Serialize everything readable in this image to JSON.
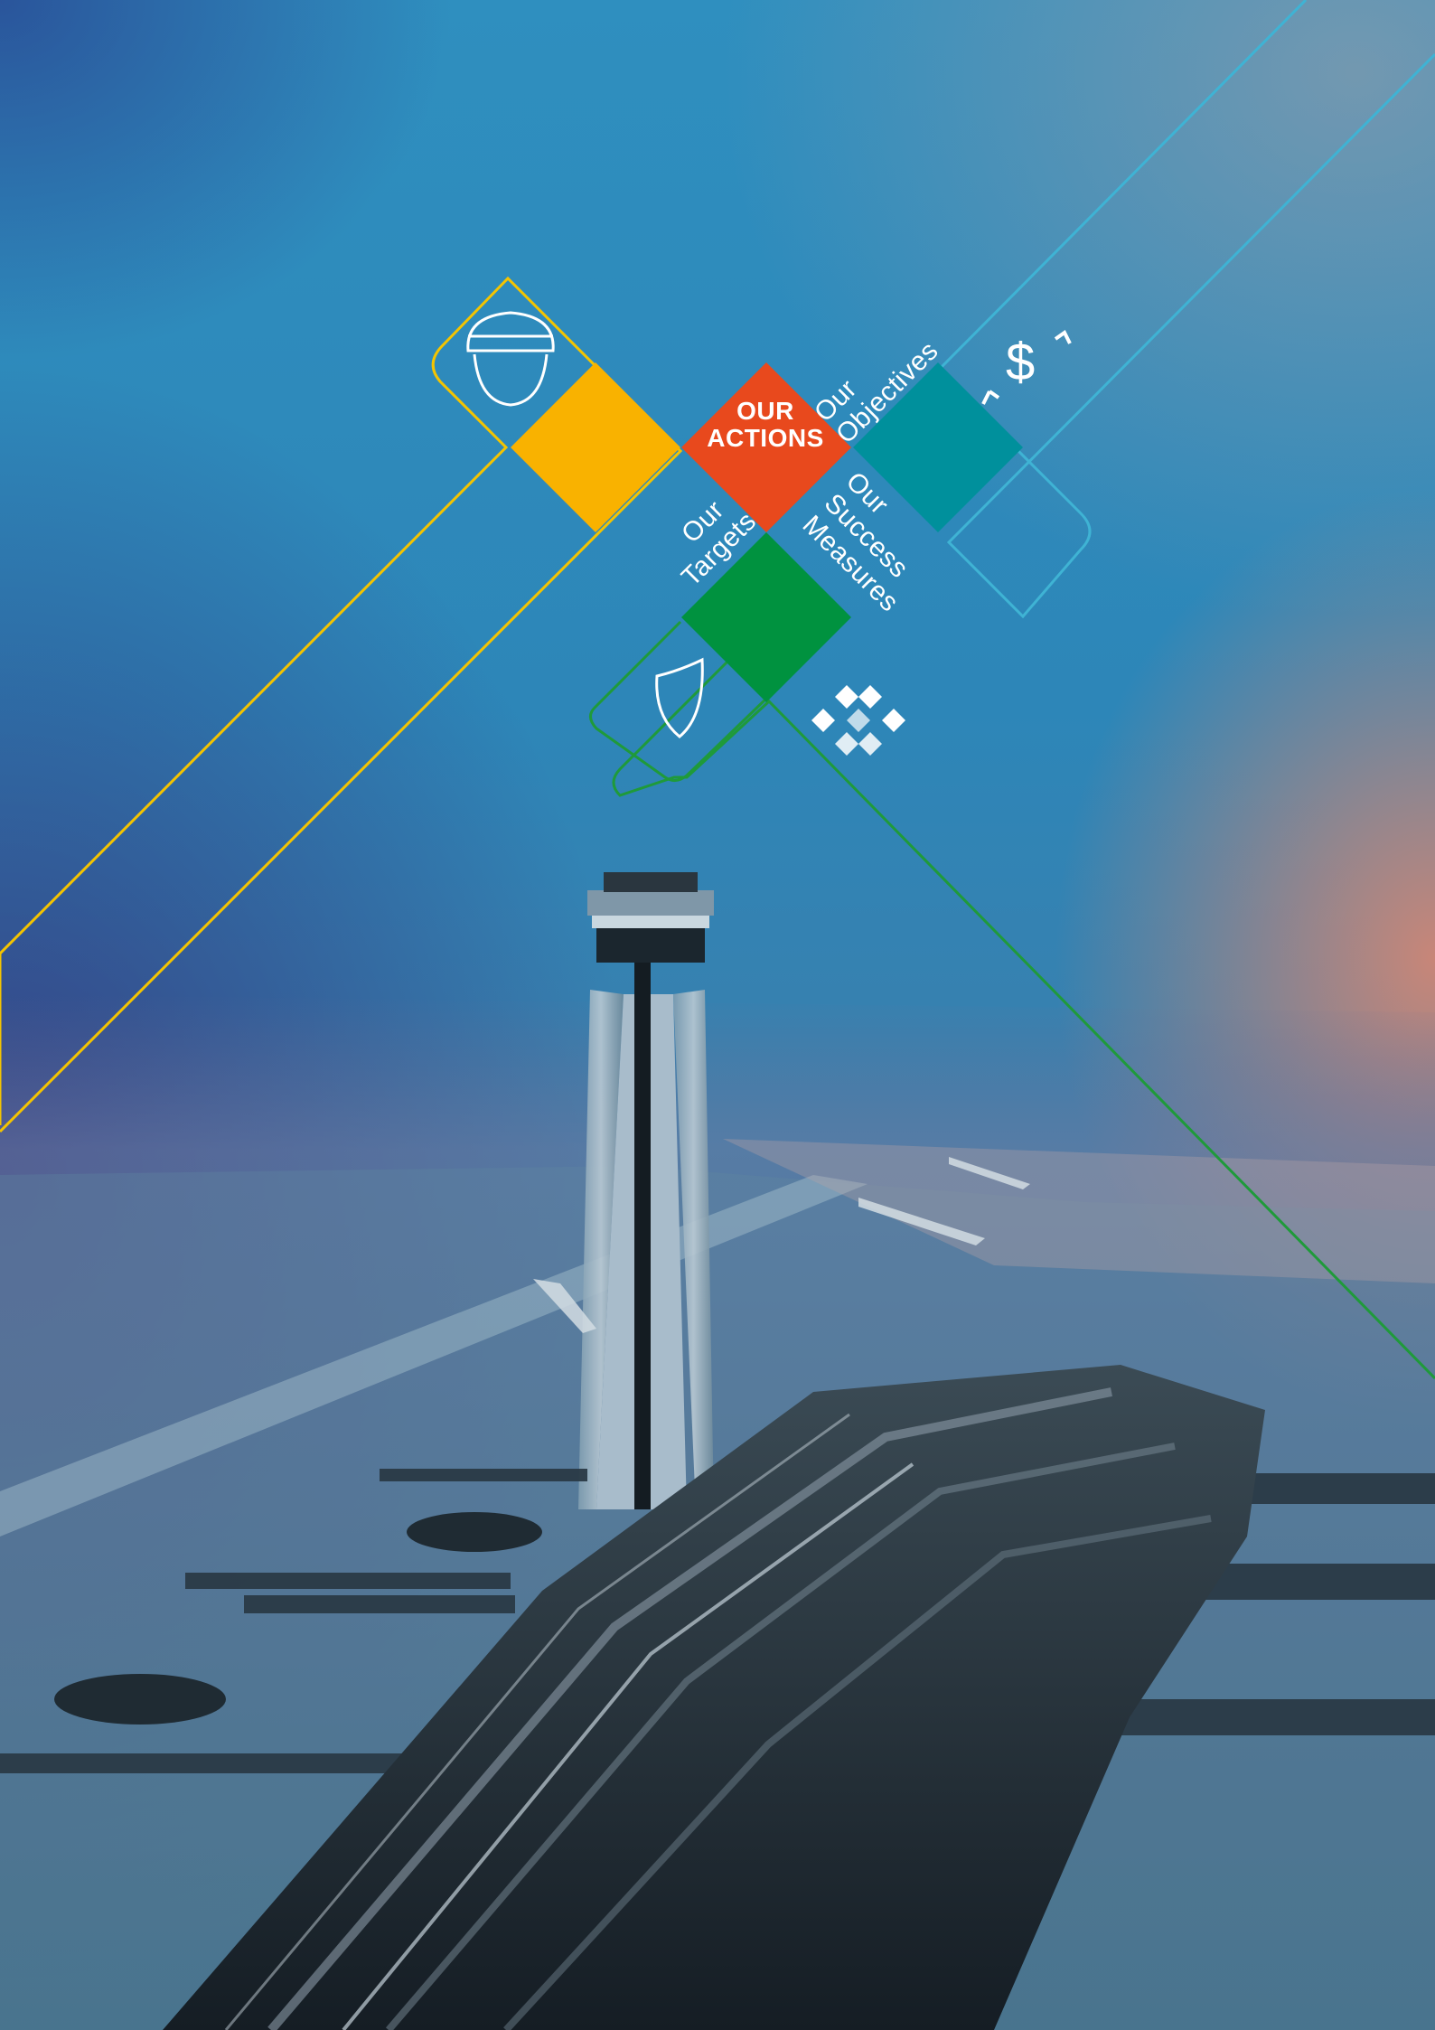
{
  "hub": {
    "title_line1": "OUR",
    "title_line2": "ACTIONS",
    "color": "#e8491d"
  },
  "branches": {
    "objectives": {
      "line1": "Our",
      "line2": "Objectives",
      "color": "#00909c",
      "icon": "dollar-arrows-icon"
    },
    "targets": {
      "line1": "Our",
      "line2": "Targets",
      "color": "#f9b200",
      "icon": "helmet-icon"
    },
    "success_measures": {
      "line1": "Our",
      "line2": "Success",
      "line3": "Measures",
      "color": "#00923f",
      "icon": "shield-icon"
    }
  },
  "accent_lines": {
    "yellow": "#f4c400",
    "blue": "#3fb3d4",
    "green": "#1f9a3a"
  },
  "emblem_icon": "star-emblem-icon",
  "background_photo": "airport-control-tower-and-terminal"
}
